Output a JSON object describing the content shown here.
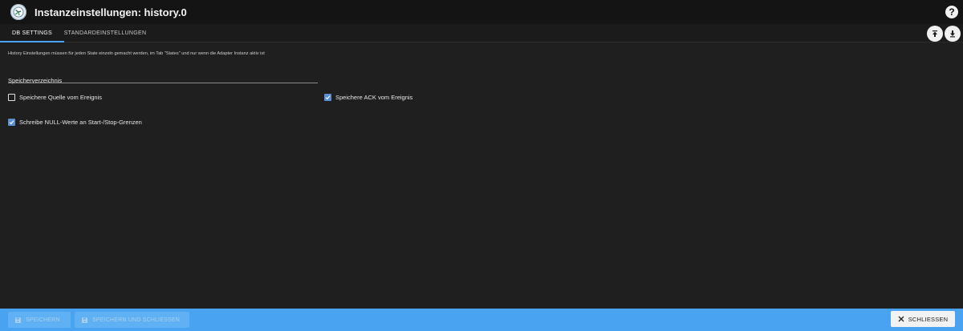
{
  "window": {
    "title": "Instanzeinstellungen: history.0",
    "logo_icon": "history-adapter-logo",
    "help_icon": "help-icon"
  },
  "tabs": [
    {
      "label": "DB SETTINGS",
      "active": true
    },
    {
      "label": "STANDARDEINSTELLUNGEN",
      "active": false
    }
  ],
  "actions": {
    "upload_icon": "upload-icon",
    "download_icon": "download-icon"
  },
  "content": {
    "info_text": "History Einstellungen müssen für jeden State einzeln gemacht werden, im Tab \"States\" und nur wenn die Adapter Instanz aktiv ist",
    "storage_dir_label": "Speicherverzeichnis",
    "checkboxes": [
      {
        "label": "Speichere Quelle vom Ereignis",
        "checked": false
      },
      {
        "label": "Speichere ACK vom Ereignis",
        "checked": true
      },
      {
        "label": "Schreibe NULL-Werte an Start-/Stop-Grenzen",
        "checked": true
      }
    ]
  },
  "footer": {
    "save_label": "SPEICHERN",
    "save_close_label": "SPEICHERN UND SCHLIESSEN",
    "close_label": "SCHLIESSEN"
  },
  "colors": {
    "accent": "#4aa3f0",
    "checkbox_checked": "#5b8fd0",
    "background": "#1f1f1f"
  }
}
